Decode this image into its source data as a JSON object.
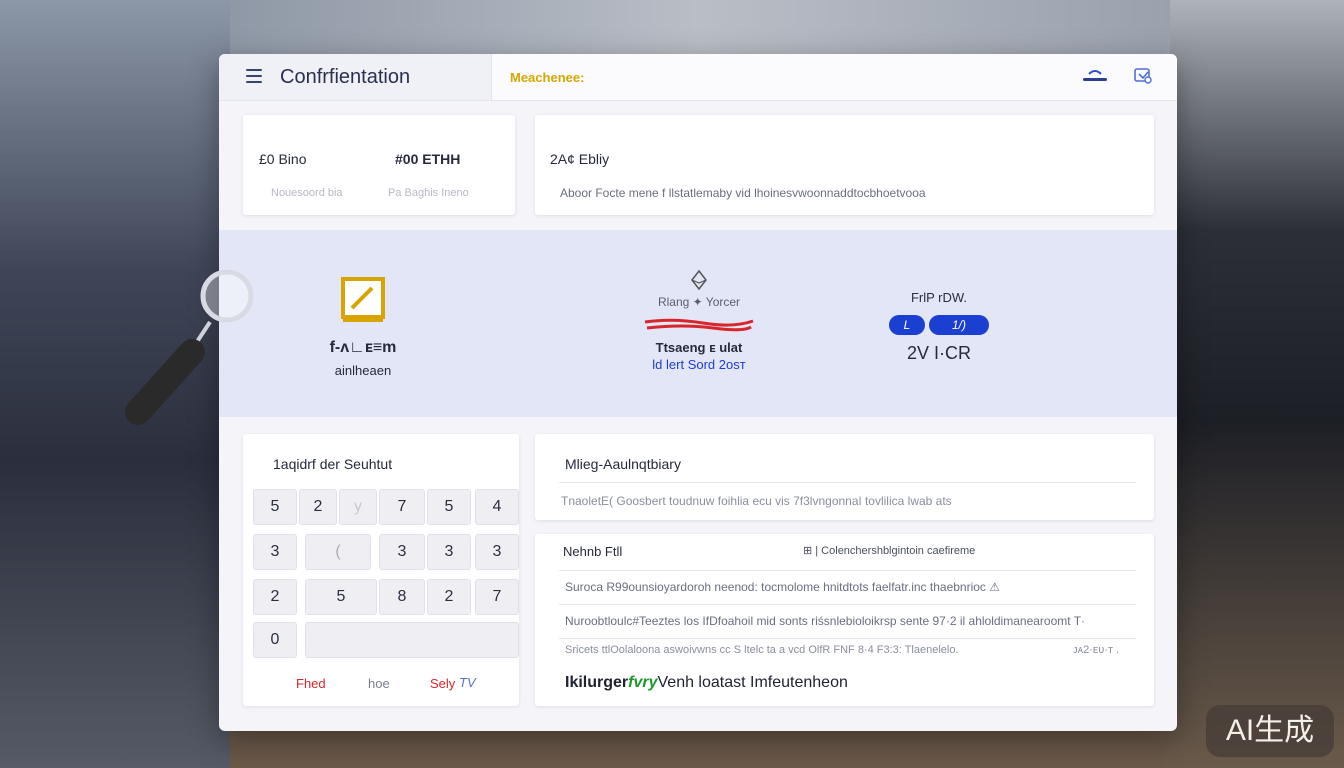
{
  "app": {
    "title": "Confrfientation",
    "status_tag": "Meachenee:"
  },
  "summary": {
    "left": {
      "label1": "£0 Bino",
      "label2": "#00 ETHH",
      "sub1": "Nouesoord bia",
      "sub2": "Pa Baghis Ineno"
    },
    "right": {
      "heading": "2A¢ Ebliy",
      "sub": "Aboor Focte mene f llstatlemaby vid lhoinesvwoonnaddtocbhoetvooa"
    }
  },
  "band": {
    "item1": {
      "line1": "f-ᴧ∟ᴇ≡m",
      "line2": "ainlheaen"
    },
    "item2": {
      "caption_top": "Rlang ✦ Yorcer",
      "line1": "Ttsaeng ᴇ ulat",
      "line2": "ld lert Sord 2osᴛ"
    },
    "item3": {
      "caption_top": "FrlP rDW.",
      "pill_left": "L",
      "pill_right": "1/)",
      "amount": "2V I·CR"
    }
  },
  "keypad": {
    "title": "1aqidrf der Seuhtut",
    "rows": [
      [
        "5",
        "2",
        "y",
        "7",
        "5",
        "4"
      ],
      [
        "3",
        "(",
        "3",
        "3",
        "3"
      ],
      [
        "2",
        "5",
        "8",
        "2",
        "7"
      ],
      [
        "0",
        ""
      ]
    ],
    "actions": {
      "fred": "Fhed",
      "hoe": "hoe",
      "sely": "Sely",
      "tv": "TV"
    }
  },
  "info": {
    "title": "Mlieg-Aaulnqtbiary",
    "desc": "TnaoletE( Goosbert toudnuw foihlia ecu vis 7f3lvngonnaǀ tovlilica lwab ats"
  },
  "details": {
    "header_left": "Nehnb Ftll",
    "header_right": "⊞ | Colenchershblgintoin caefireme",
    "rows": [
      "Suroca R99ounsioyardoroh neenod: tocmolome hnitdtots faelfatr.inc thaebnrioc ⚠",
      "Nuroobtloulc#Teeztes los IfDfoahoil mid sonts riśsnlebioloikrsp sente 97·2 il ahloldimanearoomt  T·",
      "Sricets ttlOolaloona aswoivwns cc S ltelc ta a vcd OlfR FNF 8·4 F3:3: Tlaenelelo."
    ],
    "row3_tail": "ᴊᴀ2·ᴇᴜ·ᴛ .",
    "footer_a": "Ikilurger",
    "footer_b": "fvry",
    "footer_c": "Venh loatast Imfeutenheon"
  },
  "watermark": "AI生成",
  "colors": {
    "accent_blue": "#1b3fd0",
    "band_bg": "#e3e6f6",
    "red_mark": "#d8262c",
    "gold": "#d8a400",
    "green": "#1a9a2a"
  },
  "icons": [
    "menu-icon",
    "cloud-sync-icon",
    "settings-grid-icon",
    "gold-square-icon",
    "ethereum-logo-icon",
    "magnifier-icon"
  ]
}
